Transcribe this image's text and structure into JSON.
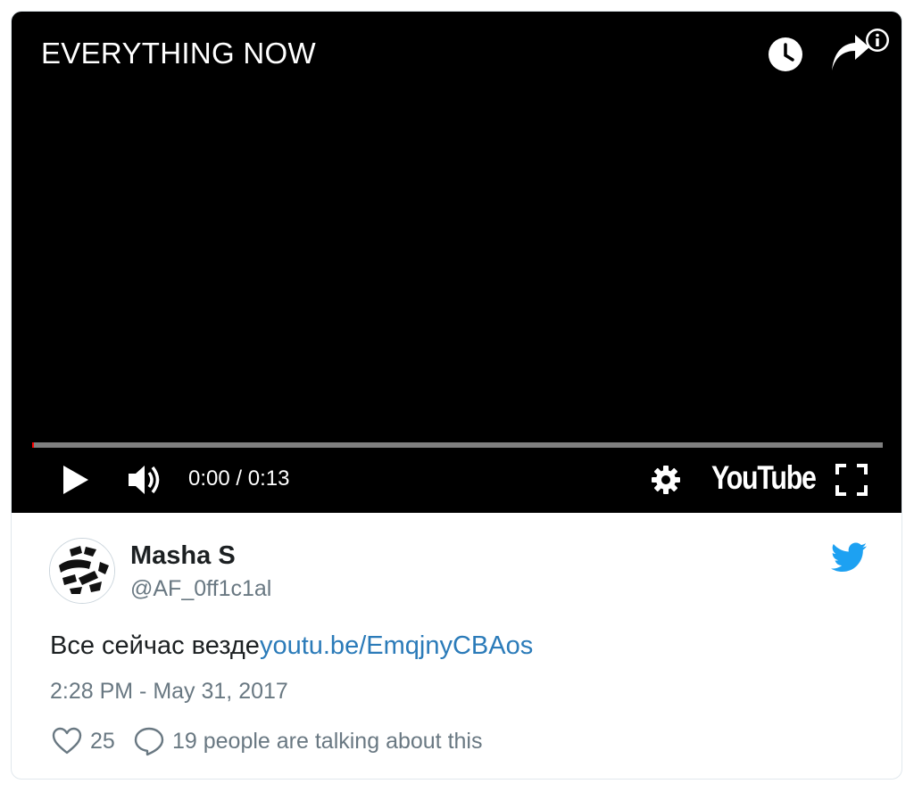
{
  "video": {
    "title": "EVERYTHING NOW",
    "time_display": "0:00 / 0:13",
    "logo_text": "YouTube",
    "progress_fraction": 0.002,
    "icons": {
      "watch_later": "clock-icon",
      "share": "share-arrow-icon",
      "info": "info-icon",
      "play": "play-icon",
      "volume": "volume-icon",
      "settings": "gear-icon",
      "fullscreen": "fullscreen-icon"
    }
  },
  "tweet": {
    "author_name": "Masha S",
    "author_handle": "@AF_0ff1c1al",
    "text": "Все сейчас везде",
    "link_text": "youtu.be/EmqjnyCBAos",
    "timestamp": "2:28 PM - May 31, 2017",
    "like_count": "25",
    "talking_text": "19 people are talking about this",
    "icons": {
      "avatar": "avatar",
      "brand": "twitter-bird-icon",
      "like": "heart-icon",
      "reply": "speech-bubble-icon"
    }
  },
  "colors": {
    "link": "#2b7bb9",
    "muted": "#697882",
    "text": "#1c2022",
    "twitter_blue": "#1da1f2",
    "player_bg": "#000000",
    "progress_played": "#ff0000"
  }
}
